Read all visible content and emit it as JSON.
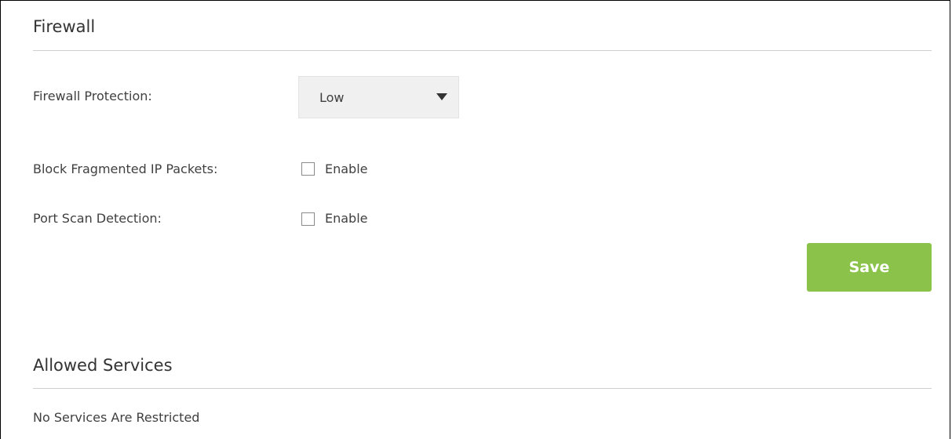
{
  "firewall": {
    "title": "Firewall",
    "protection_label": "Firewall Protection:",
    "protection_value": "Low",
    "block_fragmented_label": "Block Fragmented IP Packets:",
    "block_fragmented_option": "Enable",
    "block_fragmented_checked": false,
    "port_scan_label": "Port Scan Detection:",
    "port_scan_option": "Enable",
    "port_scan_checked": false,
    "save_label": "Save"
  },
  "allowed_services": {
    "title": "Allowed Services",
    "message": "No Services Are Restricted"
  },
  "colors": {
    "save_button": "#8bc34a",
    "divider": "#cfcfcf",
    "select_background": "#f0f0f0",
    "text": "#404040"
  },
  "icons": {
    "select_caret": "chevron-down-icon"
  }
}
